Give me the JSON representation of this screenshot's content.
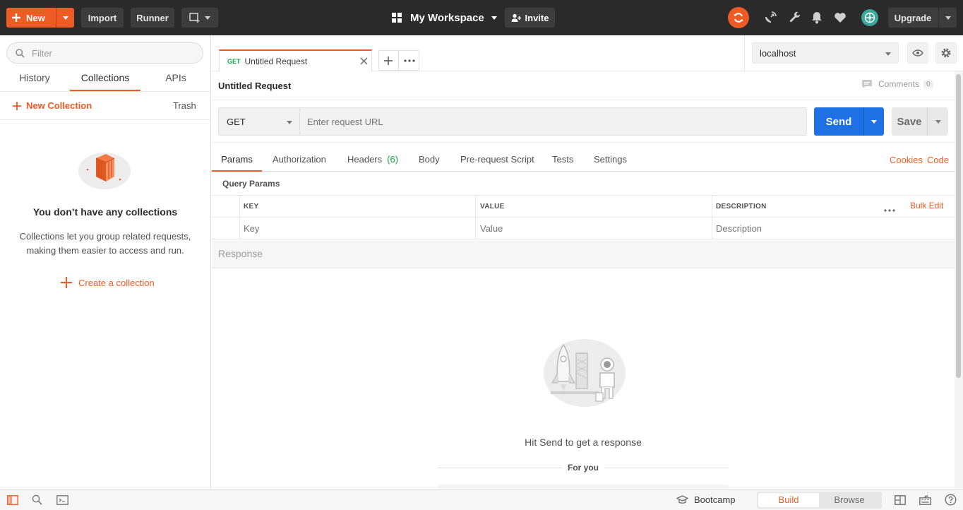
{
  "topbar": {
    "new_label": "New",
    "import_label": "Import",
    "runner_label": "Runner",
    "workspace_label": "My Workspace",
    "invite_label": "Invite",
    "upgrade_label": "Upgrade",
    "accent": "#ef5b25"
  },
  "sidebar": {
    "filter_placeholder": "Filter",
    "tabs": [
      {
        "label": "History"
      },
      {
        "label": "Collections"
      },
      {
        "label": "APIs"
      }
    ],
    "new_collection_label": "New Collection",
    "trash_label": "Trash",
    "empty_title": "You don’t have any collections",
    "empty_desc_line1": "Collections let you group related requests,",
    "empty_desc_line2": "making them easier to access and run.",
    "create_label": "Create a collection"
  },
  "request_tab": {
    "method": "GET",
    "name": "Untitled Request"
  },
  "environment": {
    "selected": "localhost"
  },
  "request": {
    "title": "Untitled Request",
    "comments_label": "Comments",
    "comments_count": "0",
    "method": "GET",
    "url_placeholder": "Enter request URL",
    "send_label": "Send",
    "save_label": "Save",
    "send_color": "#1f6fe5"
  },
  "subtabs": {
    "params": "Params",
    "authorization": "Authorization",
    "headers": "Headers",
    "headers_count": "(6)",
    "body": "Body",
    "prerequest": "Pre-request Script",
    "tests": "Tests",
    "settings": "Settings",
    "cookies": "Cookies",
    "code": "Code"
  },
  "query_params": {
    "title": "Query Params",
    "columns": [
      "KEY",
      "VALUE",
      "DESCRIPTION"
    ],
    "bulk_edit": "Bulk Edit",
    "key_placeholder": "Key",
    "value_placeholder": "Value",
    "description_placeholder": "Description"
  },
  "response": {
    "title": "Response",
    "empty_text": "Hit Send to get a response",
    "for_you": "For you"
  },
  "bottombar": {
    "bootcamp_label": "Bootcamp",
    "build_label": "Build",
    "browse_label": "Browse"
  }
}
